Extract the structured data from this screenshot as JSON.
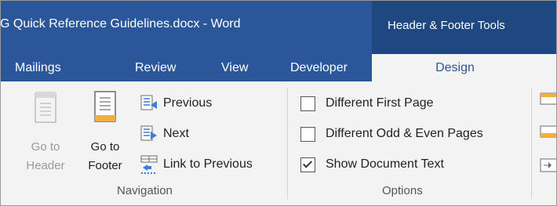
{
  "window": {
    "title": "G Quick Reference Guidelines.docx - Word",
    "contextual_group": "Header & Footer Tools"
  },
  "tabs": [
    {
      "label": "Mailings"
    },
    {
      "label": "Review"
    },
    {
      "label": "View"
    },
    {
      "label": "Developer"
    }
  ],
  "active_tab": {
    "label": "Design"
  },
  "navigation": {
    "goto_header": {
      "line1": "Go to",
      "line2": "Header",
      "enabled": false
    },
    "goto_footer": {
      "line1": "Go to",
      "line2": "Footer",
      "enabled": true
    },
    "previous": "Previous",
    "next": "Next",
    "link_to_previous": "Link to Previous",
    "group_label": "Navigation"
  },
  "options": {
    "different_first_page": {
      "label": "Different First Page",
      "checked": false
    },
    "different_odd_even": {
      "label": "Different Odd & Even Pages",
      "checked": false
    },
    "show_document_text": {
      "label": "Show Document Text",
      "checked": true
    },
    "group_label": "Options"
  },
  "colors": {
    "title_bar": "#2b579a",
    "context_header": "#1f4780",
    "ribbon_bg": "#f3f3f3",
    "accent_blue": "#2b579a",
    "icon_orange": "#f0b040",
    "icon_blue": "#3b7dd8"
  }
}
